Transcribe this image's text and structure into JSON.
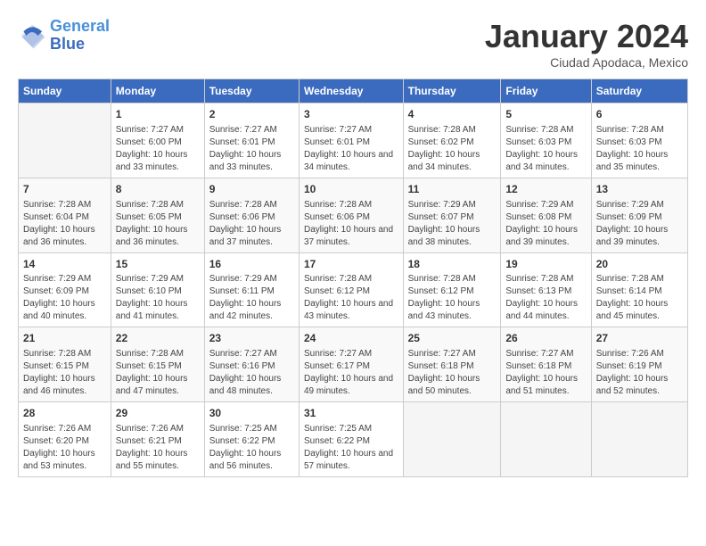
{
  "header": {
    "logo_line1": "General",
    "logo_line2": "Blue",
    "month": "January 2024",
    "location": "Ciudad Apodaca, Mexico"
  },
  "weekdays": [
    "Sunday",
    "Monday",
    "Tuesday",
    "Wednesday",
    "Thursday",
    "Friday",
    "Saturday"
  ],
  "weeks": [
    [
      {
        "day": "",
        "info": ""
      },
      {
        "day": "1",
        "info": "Sunrise: 7:27 AM\nSunset: 6:00 PM\nDaylight: 10 hours and 33 minutes."
      },
      {
        "day": "2",
        "info": "Sunrise: 7:27 AM\nSunset: 6:01 PM\nDaylight: 10 hours and 33 minutes."
      },
      {
        "day": "3",
        "info": "Sunrise: 7:27 AM\nSunset: 6:01 PM\nDaylight: 10 hours and 34 minutes."
      },
      {
        "day": "4",
        "info": "Sunrise: 7:28 AM\nSunset: 6:02 PM\nDaylight: 10 hours and 34 minutes."
      },
      {
        "day": "5",
        "info": "Sunrise: 7:28 AM\nSunset: 6:03 PM\nDaylight: 10 hours and 34 minutes."
      },
      {
        "day": "6",
        "info": "Sunrise: 7:28 AM\nSunset: 6:03 PM\nDaylight: 10 hours and 35 minutes."
      }
    ],
    [
      {
        "day": "7",
        "info": "Sunrise: 7:28 AM\nSunset: 6:04 PM\nDaylight: 10 hours and 36 minutes."
      },
      {
        "day": "8",
        "info": "Sunrise: 7:28 AM\nSunset: 6:05 PM\nDaylight: 10 hours and 36 minutes."
      },
      {
        "day": "9",
        "info": "Sunrise: 7:28 AM\nSunset: 6:06 PM\nDaylight: 10 hours and 37 minutes."
      },
      {
        "day": "10",
        "info": "Sunrise: 7:28 AM\nSunset: 6:06 PM\nDaylight: 10 hours and 37 minutes."
      },
      {
        "day": "11",
        "info": "Sunrise: 7:29 AM\nSunset: 6:07 PM\nDaylight: 10 hours and 38 minutes."
      },
      {
        "day": "12",
        "info": "Sunrise: 7:29 AM\nSunset: 6:08 PM\nDaylight: 10 hours and 39 minutes."
      },
      {
        "day": "13",
        "info": "Sunrise: 7:29 AM\nSunset: 6:09 PM\nDaylight: 10 hours and 39 minutes."
      }
    ],
    [
      {
        "day": "14",
        "info": "Sunrise: 7:29 AM\nSunset: 6:09 PM\nDaylight: 10 hours and 40 minutes."
      },
      {
        "day": "15",
        "info": "Sunrise: 7:29 AM\nSunset: 6:10 PM\nDaylight: 10 hours and 41 minutes."
      },
      {
        "day": "16",
        "info": "Sunrise: 7:29 AM\nSunset: 6:11 PM\nDaylight: 10 hours and 42 minutes."
      },
      {
        "day": "17",
        "info": "Sunrise: 7:28 AM\nSunset: 6:12 PM\nDaylight: 10 hours and 43 minutes."
      },
      {
        "day": "18",
        "info": "Sunrise: 7:28 AM\nSunset: 6:12 PM\nDaylight: 10 hours and 43 minutes."
      },
      {
        "day": "19",
        "info": "Sunrise: 7:28 AM\nSunset: 6:13 PM\nDaylight: 10 hours and 44 minutes."
      },
      {
        "day": "20",
        "info": "Sunrise: 7:28 AM\nSunset: 6:14 PM\nDaylight: 10 hours and 45 minutes."
      }
    ],
    [
      {
        "day": "21",
        "info": "Sunrise: 7:28 AM\nSunset: 6:15 PM\nDaylight: 10 hours and 46 minutes."
      },
      {
        "day": "22",
        "info": "Sunrise: 7:28 AM\nSunset: 6:15 PM\nDaylight: 10 hours and 47 minutes."
      },
      {
        "day": "23",
        "info": "Sunrise: 7:27 AM\nSunset: 6:16 PM\nDaylight: 10 hours and 48 minutes."
      },
      {
        "day": "24",
        "info": "Sunrise: 7:27 AM\nSunset: 6:17 PM\nDaylight: 10 hours and 49 minutes."
      },
      {
        "day": "25",
        "info": "Sunrise: 7:27 AM\nSunset: 6:18 PM\nDaylight: 10 hours and 50 minutes."
      },
      {
        "day": "26",
        "info": "Sunrise: 7:27 AM\nSunset: 6:18 PM\nDaylight: 10 hours and 51 minutes."
      },
      {
        "day": "27",
        "info": "Sunrise: 7:26 AM\nSunset: 6:19 PM\nDaylight: 10 hours and 52 minutes."
      }
    ],
    [
      {
        "day": "28",
        "info": "Sunrise: 7:26 AM\nSunset: 6:20 PM\nDaylight: 10 hours and 53 minutes."
      },
      {
        "day": "29",
        "info": "Sunrise: 7:26 AM\nSunset: 6:21 PM\nDaylight: 10 hours and 55 minutes."
      },
      {
        "day": "30",
        "info": "Sunrise: 7:25 AM\nSunset: 6:22 PM\nDaylight: 10 hours and 56 minutes."
      },
      {
        "day": "31",
        "info": "Sunrise: 7:25 AM\nSunset: 6:22 PM\nDaylight: 10 hours and 57 minutes."
      },
      {
        "day": "",
        "info": ""
      },
      {
        "day": "",
        "info": ""
      },
      {
        "day": "",
        "info": ""
      }
    ]
  ]
}
